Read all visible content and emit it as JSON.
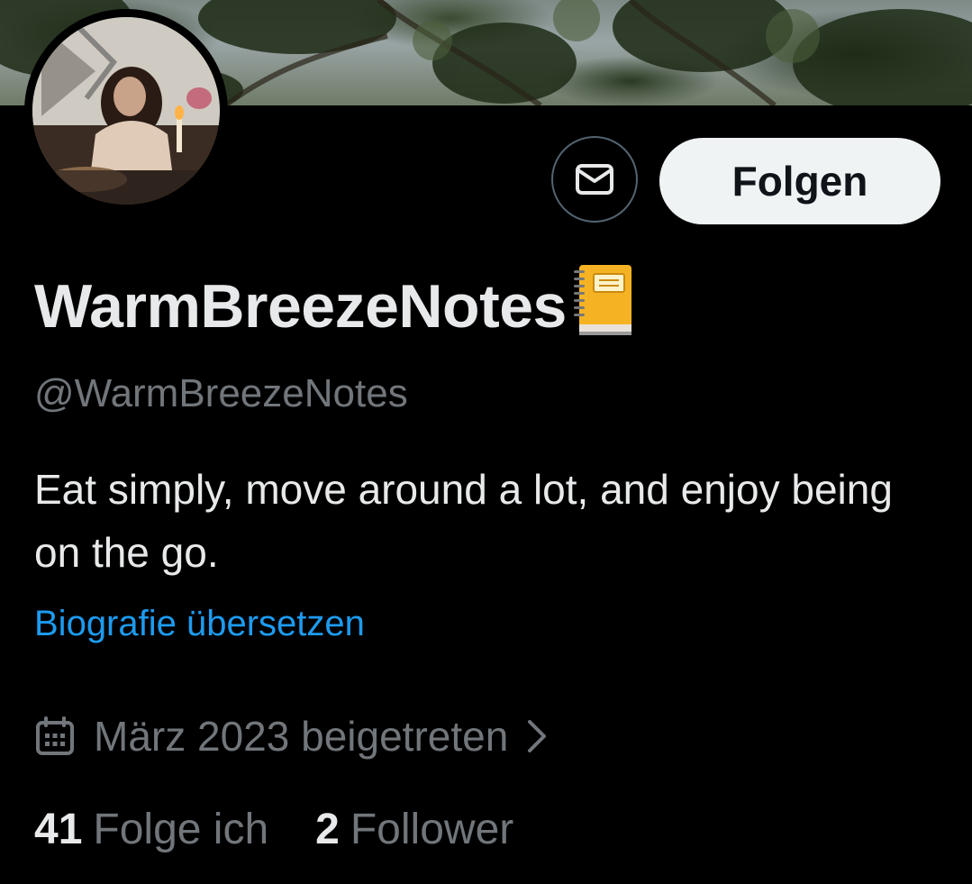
{
  "profile": {
    "display_name": "WarmBreezeNotes",
    "display_name_emoji": "notebook-emoji",
    "handle": "@WarmBreezeNotes",
    "bio": "Eat simply, move around a lot, and enjoy being on the go.",
    "translate_link": "Biografie übersetzen",
    "joined": "März 2023 beigetreten"
  },
  "actions": {
    "follow_label": "Folgen",
    "message_icon": "envelope-icon"
  },
  "stats": {
    "following_count": "41",
    "following_label": "Folge ich",
    "followers_count": "2",
    "followers_label": "Follower"
  },
  "colors": {
    "background": "#000000",
    "primary_text": "#e7e9ea",
    "secondary_text": "#71767b",
    "link": "#1d9bf0",
    "follow_button_bg": "#eff3f4"
  }
}
